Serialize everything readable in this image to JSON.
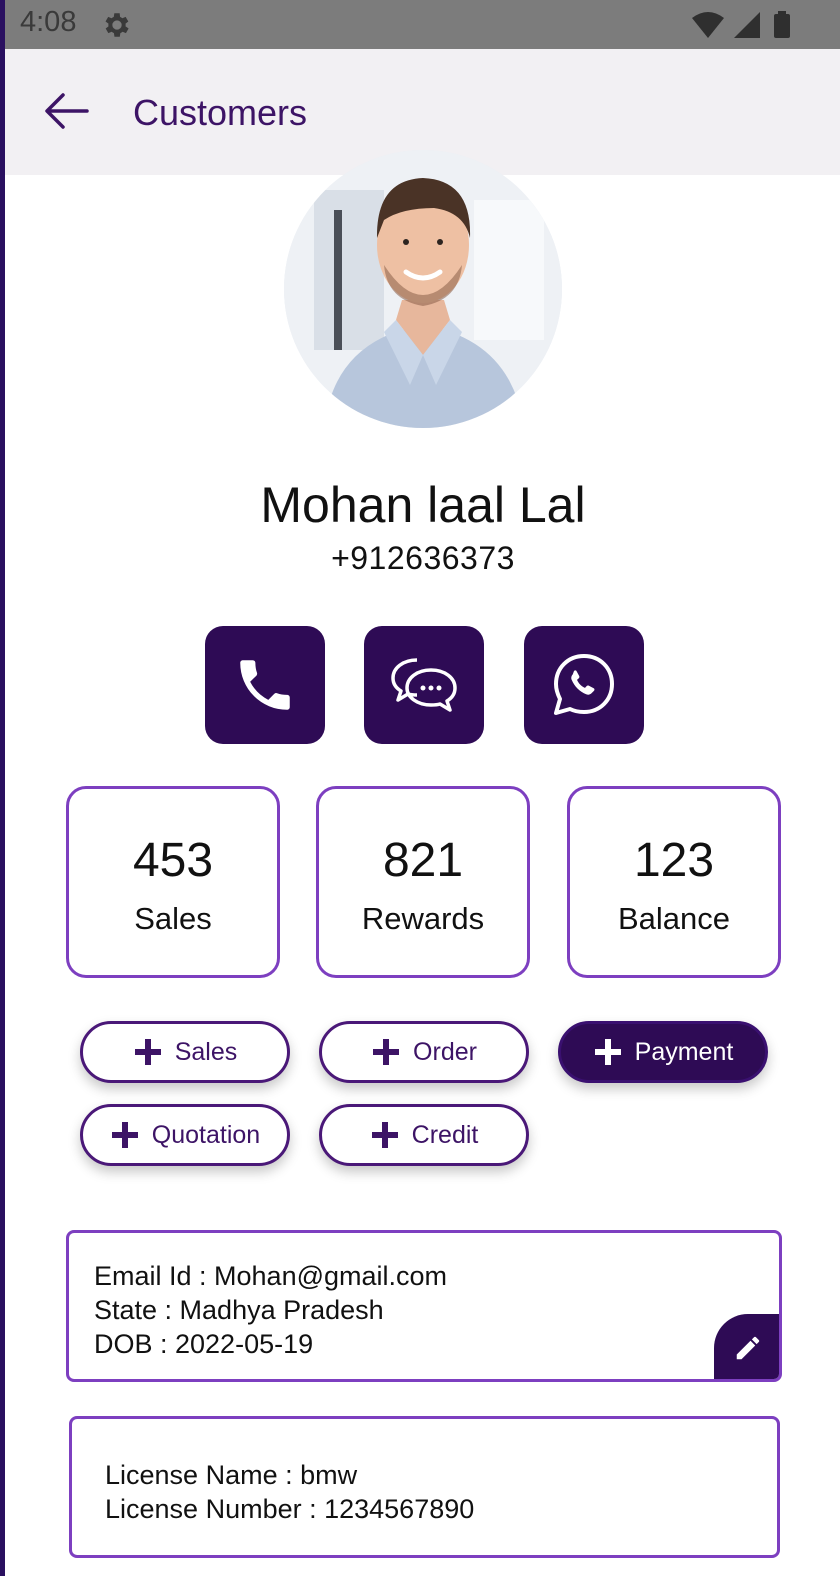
{
  "status_bar": {
    "time": "4:08",
    "icons": [
      "gear-icon",
      "wifi-icon",
      "signal-icon",
      "battery-icon"
    ]
  },
  "app_bar": {
    "title": "Customers",
    "back_icon": "arrow-left-icon"
  },
  "customer": {
    "name": "Mohan laal Lal",
    "phone": "+912636373"
  },
  "contact_actions": [
    {
      "icon": "phone-icon"
    },
    {
      "icon": "chat-bubbles-icon"
    },
    {
      "icon": "whatsapp-icon"
    }
  ],
  "stats": [
    {
      "value": "453",
      "label": "Sales"
    },
    {
      "value": "821",
      "label": "Rewards"
    },
    {
      "value": "123",
      "label": "Balance"
    }
  ],
  "quick_add": [
    {
      "label": "Sales",
      "icon": "plus-icon"
    },
    {
      "label": "Order",
      "icon": "plus-icon"
    },
    {
      "label": "Payment",
      "icon": "plus-icon"
    },
    {
      "label": "Quotation",
      "icon": "plus-icon"
    },
    {
      "label": "Credit",
      "icon": "plus-icon"
    }
  ],
  "details": {
    "email": "Email Id : Mohan@gmail.com",
    "state": "State : Madhya Pradesh",
    "dob": "DOB : 2022-05-19",
    "edit_icon": "pencil-icon"
  },
  "license": {
    "name": "License Name : bmw",
    "number": "License Number : 1234567890"
  },
  "colors": {
    "primary": "#2e0b55",
    "card_border": "#7d3fc0",
    "title_text": "#3d1466",
    "app_bar_bg": "#f2f0f3",
    "status_bar_bg": "#7c7c7c"
  }
}
